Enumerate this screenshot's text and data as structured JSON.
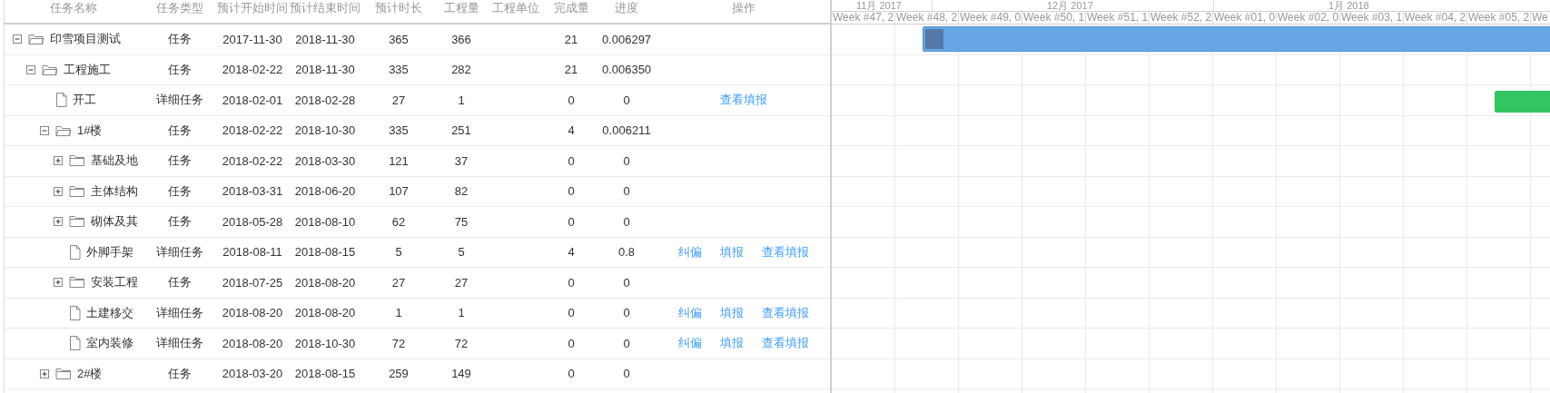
{
  "grid": {
    "columns": [
      "任务名称",
      "任务类型",
      "预计开始时间",
      "预计结束时间",
      "预计时长",
      "工程量",
      "工程单位",
      "完成量",
      "进度",
      "操作"
    ],
    "rows": [
      {
        "name": "印雪项目测试",
        "kind": "task",
        "expanded": true,
        "type": "任务",
        "start": "2017-11-30",
        "end": "2018-11-30",
        "duration": "365",
        "quantity": "366",
        "done": "21",
        "progress": "0.006297",
        "children": [
          {
            "name": "工程施工",
            "kind": "task",
            "expanded": true,
            "type": "任务",
            "start": "2018-02-22",
            "end": "2018-11-30",
            "duration": "335",
            "quantity": "282",
            "done": "21",
            "progress": "0.006350",
            "children": [
              {
                "name": "开工",
                "kind": "detail",
                "type": "详细任务",
                "start": "2018-02-01",
                "end": "2018-02-28",
                "duration": "27",
                "quantity": "1",
                "done": "0",
                "progress": "0",
                "actions": [
                  "查看填报"
                ]
              },
              {
                "name": "1#楼",
                "kind": "task",
                "expanded": true,
                "type": "任务",
                "start": "2018-02-22",
                "end": "2018-10-30",
                "duration": "335",
                "quantity": "251",
                "done": "4",
                "progress": "0.006211",
                "children": [
                  {
                    "name": "基础及地",
                    "kind": "task",
                    "expanded": false,
                    "type": "任务",
                    "start": "2018-02-22",
                    "end": "2018-03-30",
                    "duration": "121",
                    "quantity": "37",
                    "done": "0",
                    "progress": "0"
                  },
                  {
                    "name": "主体结构",
                    "kind": "task",
                    "expanded": false,
                    "type": "任务",
                    "start": "2018-03-31",
                    "end": "2018-06-20",
                    "duration": "107",
                    "quantity": "82",
                    "done": "0",
                    "progress": "0"
                  },
                  {
                    "name": "砌体及其",
                    "kind": "task",
                    "expanded": false,
                    "type": "任务",
                    "start": "2018-05-28",
                    "end": "2018-08-10",
                    "duration": "62",
                    "quantity": "75",
                    "done": "0",
                    "progress": "0"
                  },
                  {
                    "name": "外脚手架",
                    "kind": "detail",
                    "type": "详细任务",
                    "start": "2018-08-11",
                    "end": "2018-08-15",
                    "duration": "5",
                    "quantity": "5",
                    "done": "4",
                    "progress": "0.8",
                    "actions": [
                      "纠偏",
                      "填报",
                      "查看填报"
                    ]
                  },
                  {
                    "name": "安装工程",
                    "kind": "task",
                    "expanded": false,
                    "type": "任务",
                    "start": "2018-07-25",
                    "end": "2018-08-20",
                    "duration": "27",
                    "quantity": "27",
                    "done": "0",
                    "progress": "0"
                  },
                  {
                    "name": "土建移交",
                    "kind": "detail",
                    "type": "详细任务",
                    "start": "2018-08-20",
                    "end": "2018-08-20",
                    "duration": "1",
                    "quantity": "1",
                    "done": "0",
                    "progress": "0",
                    "actions": [
                      "纠偏",
                      "填报",
                      "查看填报"
                    ]
                  },
                  {
                    "name": "室内装修",
                    "kind": "detail",
                    "type": "详细任务",
                    "start": "2018-08-20",
                    "end": "2018-10-30",
                    "duration": "72",
                    "quantity": "72",
                    "done": "0",
                    "progress": "0",
                    "actions": [
                      "纠偏",
                      "填报",
                      "查看填报"
                    ]
                  }
                ]
              },
              {
                "name": "2#楼",
                "kind": "task",
                "expanded": false,
                "type": "任务",
                "start": "2018-03-20",
                "end": "2018-08-15",
                "duration": "259",
                "quantity": "149",
                "done": "0",
                "progress": "0"
              }
            ]
          }
        ]
      }
    ]
  },
  "timeline": {
    "months": [
      "11月 2017",
      "12月 2017",
      "1月 2018"
    ],
    "weeks": [
      "Week #47, 2",
      "Week #48, 2",
      "Week #49, 0",
      "Week #50, 1",
      "Week #51, 1",
      "Week #52, 2",
      "Week #01, 0",
      "Week #02, 0",
      "Week #03, 1",
      "Week #04, 2",
      "Week #05, 2",
      "We"
    ]
  }
}
